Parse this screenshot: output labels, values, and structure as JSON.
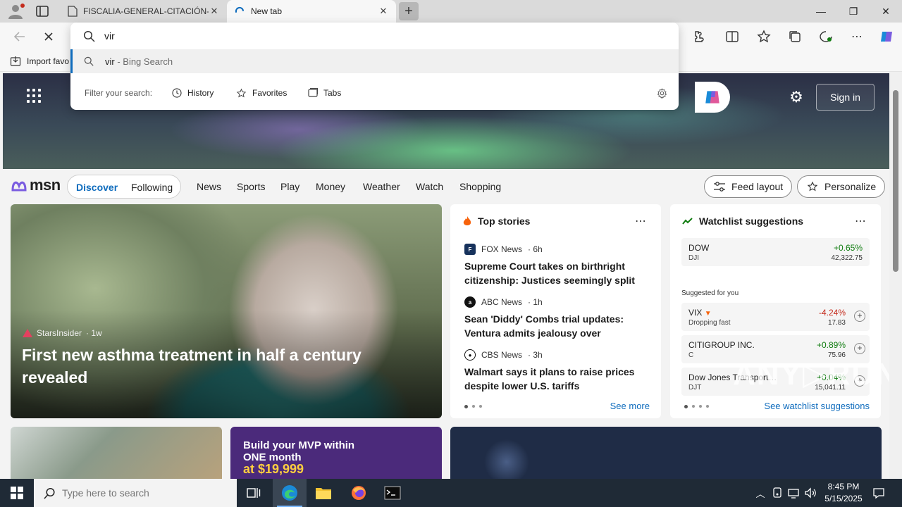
{
  "browser": {
    "tabs": [
      {
        "title": "FISCALIA-GENERAL-CITACIÓN-P",
        "close": "✕"
      },
      {
        "title": "New tab",
        "close": "✕"
      }
    ],
    "new_tab_symbol": "+",
    "window_controls": {
      "minimize": "—",
      "restore": "❐",
      "close": "✕"
    },
    "favorites_bar": {
      "import_label": "Import favo"
    }
  },
  "omnibox": {
    "value": "vir",
    "suggestion": {
      "query": "vir",
      "suffix": " - Bing Search"
    },
    "filter": {
      "label": "Filter your search:",
      "chips": [
        "History",
        "Favorites",
        "Tabs"
      ]
    }
  },
  "msn": {
    "sign_in": "Sign in",
    "brand": "msn",
    "segments": [
      "Discover",
      "Following"
    ],
    "nav": [
      "News",
      "Sports",
      "Play",
      "Money",
      "Weather",
      "Watch",
      "Shopping"
    ],
    "feed_layout": "Feed layout",
    "personalize": "Personalize",
    "hero_story": {
      "source": "StarsInsider",
      "age": "· 1w",
      "title": "First new asthma treatment in half a century revealed"
    },
    "top_stories": {
      "heading": "Top stories",
      "items": [
        {
          "source": "FOX News",
          "age": "· 6h",
          "title": "Supreme Court takes on birthright citizenship: Justices seemingly split on…"
        },
        {
          "source": "ABC News",
          "age": "· 1h",
          "title": "Sean 'Diddy' Combs trial updates: Ventura admits jealousy over Combs'…"
        },
        {
          "source": "CBS News",
          "age": "· 3h",
          "title": "Walmart says it plans to raise prices despite lower U.S. tariffs"
        }
      ],
      "see_more": "See more"
    },
    "watchlist": {
      "heading": "Watchlist suggestions",
      "main": {
        "name": "DOW",
        "symbol": "DJI",
        "change": "+0.65%",
        "price": "42,322.75"
      },
      "suggested_label": "Suggested for you",
      "items": [
        {
          "name": "VIX",
          "symbol": "Dropping fast",
          "change": "-4.24%",
          "price": "17.83",
          "direction": "down"
        },
        {
          "name": "CITIGROUP INC.",
          "symbol": "C",
          "change": "+0.89%",
          "price": "75.96",
          "direction": "up"
        },
        {
          "name": "Dow Jones Transport…",
          "symbol": "DJT",
          "change": "+0.04%",
          "price": "15,041.11",
          "direction": "up"
        }
      ],
      "see_all": "See watchlist suggestions"
    },
    "ad": {
      "line1": "Build your MVP within",
      "line2": "ONE month",
      "line3": "at $19,999"
    }
  },
  "watermark": "ANY▷RUN",
  "taskbar": {
    "search_placeholder": "Type here to search",
    "time": "8:45 PM",
    "date": "5/15/2025"
  },
  "colors": {
    "accent": "#0f6cbd",
    "up": "#107c10",
    "down": "#c42b1c",
    "taskbar": "#1f2a36"
  }
}
